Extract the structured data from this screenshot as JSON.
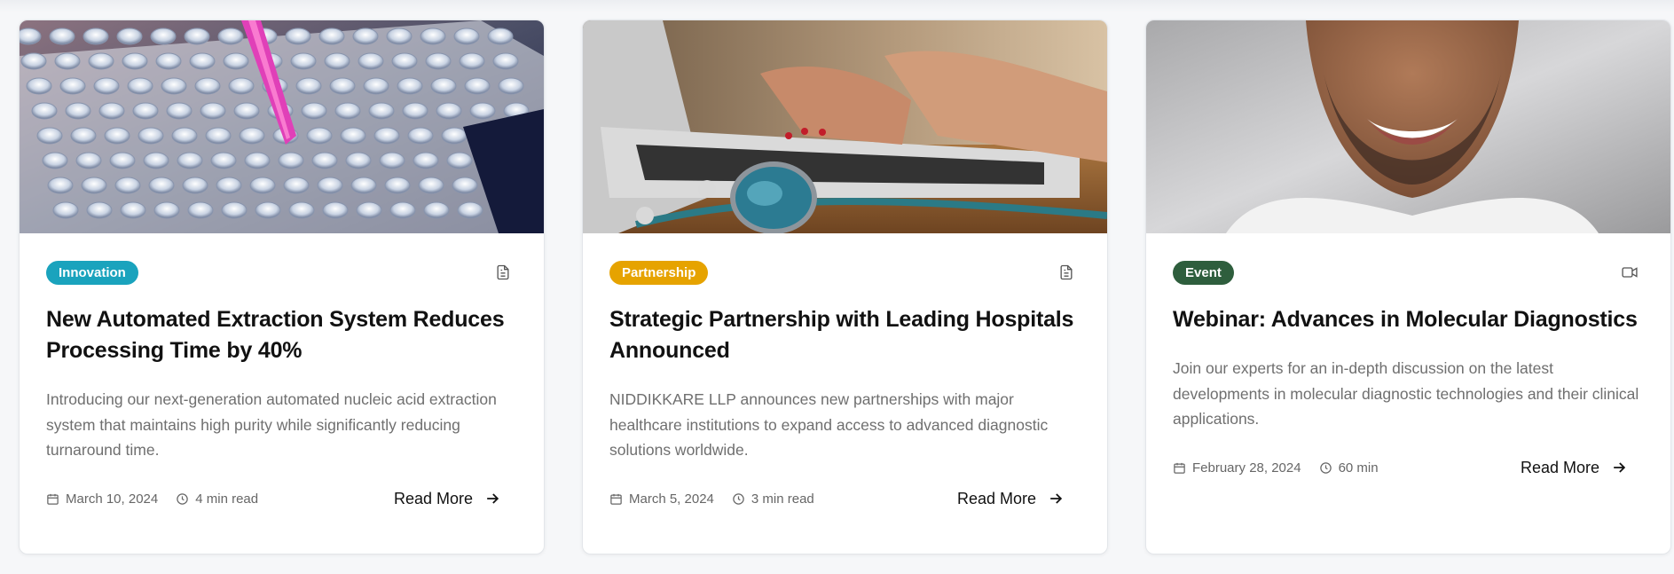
{
  "cards": [
    {
      "image_alt": "pipette dispensing pink liquid into rack of test tubes",
      "category": "Innovation",
      "category_color": "#1aa3bd",
      "type_icon": "document-icon",
      "title": "New Automated Extraction System Reduces Processing Time by 40%",
      "description": "Introducing our next-generation automated nucleic acid extraction system that maintains high purity while significantly reducing turnaround time.",
      "date": "March 10, 2024",
      "duration": "4 min read",
      "cta": "Read More"
    },
    {
      "image_alt": "hands typing on laptop with stethoscope",
      "category": "Partnership",
      "category_color": "#e6a300",
      "type_icon": "document-icon",
      "title": "Strategic Partnership with Leading Hospitals Announced",
      "description": "NIDDIKKARE LLP announces new partnerships with major healthcare institutions to expand access to advanced diagnostic solutions worldwide.",
      "date": "March 5, 2024",
      "duration": "3 min read",
      "cta": "Read More"
    },
    {
      "image_alt": "smiling bearded man",
      "category": "Event",
      "category_color": "#2e5e3d",
      "type_icon": "video-icon",
      "title": "Webinar: Advances in Molecular Diagnostics",
      "description": "Join our experts for an in-depth discussion on the latest developments in molecular diagnostic technologies and their clinical applications.",
      "date": "February 28, 2024",
      "duration": "60 min",
      "cta": "Read More"
    }
  ]
}
